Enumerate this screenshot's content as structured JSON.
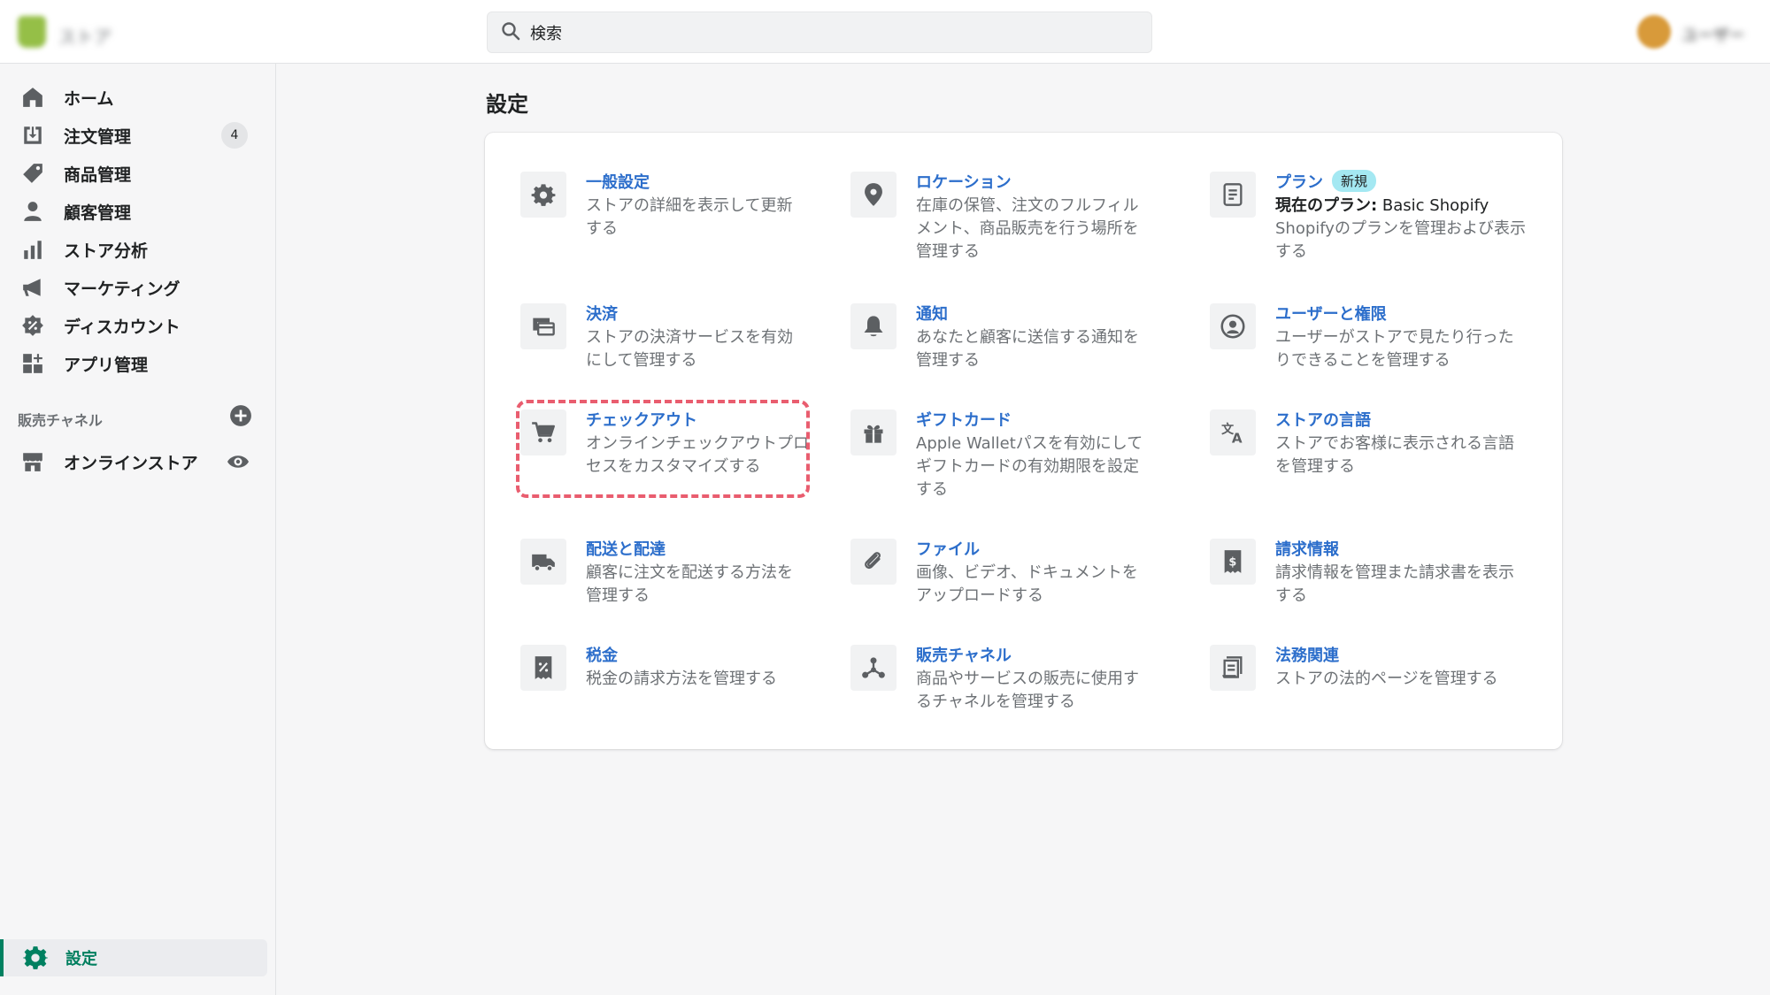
{
  "topbar": {
    "store_name": "ストア",
    "search_placeholder": "検索",
    "user_name": "ユーザー"
  },
  "sidebar": {
    "items": [
      {
        "label": "ホーム",
        "icon": "home-icon"
      },
      {
        "label": "注文管理",
        "icon": "orders-icon",
        "badge": "4"
      },
      {
        "label": "商品管理",
        "icon": "tag-icon"
      },
      {
        "label": "顧客管理",
        "icon": "customer-icon"
      },
      {
        "label": "ストア分析",
        "icon": "analytics-icon"
      },
      {
        "label": "マーケティング",
        "icon": "megaphone-icon"
      },
      {
        "label": "ディスカウント",
        "icon": "discount-icon"
      },
      {
        "label": "アプリ管理",
        "icon": "apps-icon"
      }
    ],
    "channels_heading": "販売チャネル",
    "online_store": "オンラインストア",
    "settings": "設定"
  },
  "page": {
    "title": "設定"
  },
  "settings": [
    {
      "title": "一般設定",
      "desc": "ストアの詳細を表示して更新する",
      "icon": "gear-icon"
    },
    {
      "title": "ロケーション",
      "desc": "在庫の保管、注文のフルフィルメント、商品販売を行う場所を管理する",
      "icon": "location-pin-icon"
    },
    {
      "title": "プラン",
      "badge": "新規",
      "plan_label": "現在のプラン:",
      "plan_value": " Basic Shopify",
      "desc": "Shopifyのプランを管理および表示する",
      "icon": "plan-icon"
    },
    {
      "title": "決済",
      "desc": "ストアの決済サービスを有効にして管理する",
      "icon": "payments-icon"
    },
    {
      "title": "通知",
      "desc": "あなたと顧客に送信する通知を管理する",
      "icon": "bell-icon"
    },
    {
      "title": "ユーザーと権限",
      "desc": "ユーザーがストアで見たり行ったりできることを管理する",
      "icon": "user-circle-icon"
    },
    {
      "title": "チェックアウト",
      "desc": "オンラインチェックアウトプロセスをカスタマイズする",
      "icon": "cart-icon"
    },
    {
      "title": "ギフトカード",
      "desc": "Apple Walletパスを有効にしてギフトカードの有効期限を設定する",
      "icon": "gift-icon"
    },
    {
      "title": "ストアの言語",
      "desc": "ストアでお客様に表示される言語を管理する",
      "icon": "translate-icon"
    },
    {
      "title": "配送と配達",
      "desc": "顧客に注文を配送する方法を管理する",
      "icon": "truck-icon"
    },
    {
      "title": "ファイル",
      "desc": "画像、ビデオ、ドキュメントをアップロードする",
      "icon": "paperclip-icon"
    },
    {
      "title": "請求情報",
      "desc": "請求情報を管理また請求書を表示する",
      "icon": "billing-icon"
    },
    {
      "title": "税金",
      "desc": "税金の請求方法を管理する",
      "icon": "tax-icon"
    },
    {
      "title": "販売チャネル",
      "desc": "商品やサービスの販売に使用するチャネルを管理する",
      "icon": "channels-icon"
    },
    {
      "title": "法務関連",
      "desc": "ストアの法的ページを管理する",
      "icon": "legal-icon"
    }
  ],
  "colors": {
    "link": "#2c6ecb",
    "accent": "#008060",
    "highlight": "#e95d6f"
  }
}
